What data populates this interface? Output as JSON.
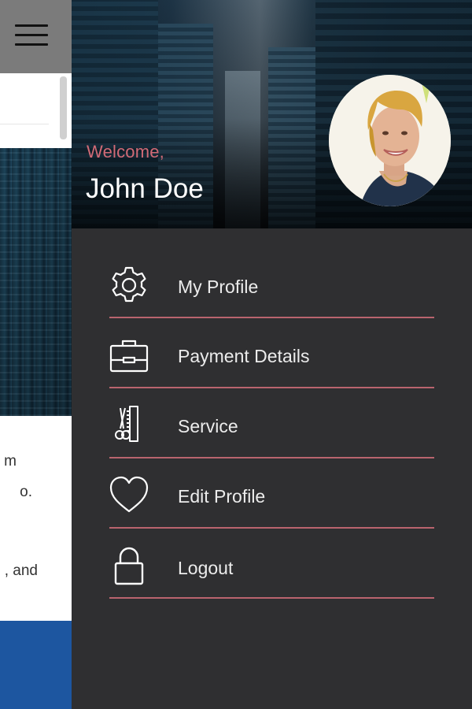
{
  "background": {
    "text_lines": [
      "m",
      "o.",
      ", and"
    ],
    "colors": {
      "topbar": "#7b7b7b",
      "footer": "#1d56a0"
    }
  },
  "drawer": {
    "welcome_label": "Welcome,",
    "user_name": "John Doe",
    "accent_color": "#d16a76",
    "menu": [
      {
        "label": "My Profile",
        "icon": "gear-icon"
      },
      {
        "label": "Payment Details",
        "icon": "briefcase-icon"
      },
      {
        "label": "Service",
        "icon": "scissors-comb-icon"
      },
      {
        "label": "Edit Profile",
        "icon": "heart-icon"
      },
      {
        "label": "Logout",
        "icon": "lock-icon"
      }
    ]
  }
}
